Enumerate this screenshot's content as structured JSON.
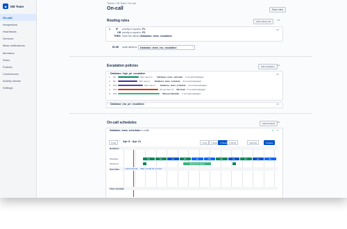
{
  "team": {
    "name": "DB Team"
  },
  "sidebar": {
    "items": [
      {
        "label": "On-call",
        "active": true
      },
      {
        "label": "Integrations"
      },
      {
        "label": "Heartbeats"
      },
      {
        "label": "Services"
      },
      {
        "label": "Mass notifications"
      },
      {
        "label": "Members"
      },
      {
        "label": "Roles"
      },
      {
        "label": "Policies"
      },
      {
        "label": "Conferences"
      },
      {
        "label": "Activity stream"
      },
      {
        "label": "Settings"
      }
    ]
  },
  "header": {
    "breadcrumb": [
      "Teams",
      "DB Team",
      "On-call"
    ],
    "title": "On-call",
    "save_label": "Save view"
  },
  "routing": {
    "title": "Routing rules",
    "add_label": "Add routing rule",
    "rule_num": "1",
    "if_label": "IF",
    "cond_text": "priority is equal to",
    "cond_val": "P1",
    "and_label": "OR",
    "cond2_text": "priority is equal to",
    "cond2_val": "P2",
    "then_label": "THEN",
    "then_text": "route the alerts to",
    "then_target": "Database_team_escalation",
    "else_label": "ELSE",
    "else_text": "route alerts to",
    "else_target": "Database_team_esc_escalation"
  },
  "escalation": {
    "title": "Escalation policies",
    "add_label": "Add escalation",
    "policy1": "Database_high_pri_escalation",
    "steps": [
      {
        "num": "1",
        "time": "0m",
        "text": "Alert users in",
        "target": "Database_team_schedule",
        "tail": "if not acknowledged",
        "color": "#00875a"
      },
      {
        "num": "2",
        "time": "5m",
        "text": "Alert user in",
        "target": "Database_team_schedule",
        "tail": "if not acknowledged",
        "color": "#403294"
      },
      {
        "num": "3",
        "time": "10m",
        "text": "Alert user in",
        "target": "Database_team_schedule",
        "tail": "if not acknowledged",
        "color": "#5243aa"
      },
      {
        "num": "4",
        "time": "15m",
        "text": "All members of",
        "target": "DB Team",
        "tail": "if not acknowledged",
        "color": "#de350b"
      },
      {
        "num": "5",
        "time": "20m",
        "text": "",
        "target": "Melissa Rebekah",
        "tail": "if not acknowledged",
        "color": "#36b37e"
      }
    ],
    "policy2": "Database_low_pri_escalation"
  },
  "schedules": {
    "title": "On-call schedules",
    "add_label": "Add schedule",
    "schedule_name": "Database_team_schedule",
    "timezone": "(GMT+03:00)",
    "today_label": "Today",
    "date_range": "Apr 8 - Apr 21",
    "views": [
      "1 Day",
      "1 Week",
      "2 Weeks",
      "1 Month"
    ],
    "active_view": "2 Weeks",
    "calendar_label": "Calendar",
    "timeline_label": "Timeline",
    "rotations_label": "Rotations",
    "rot1": "Weekday",
    "rot2": "Weekend",
    "rot2_tag": "Weekend rotation",
    "overrides_label": "Overrides",
    "add_override": "Add override",
    "take_call": "Take on-call for an hour",
    "final_label": "Final schedule",
    "row1": [
      {
        "name": "BA",
        "color": "#00875a"
      },
      {
        "name": "BA",
        "color": "#00875a"
      },
      {
        "name": "AA",
        "color": "#0052cc"
      },
      {
        "name": "BA",
        "color": "#00875a"
      },
      {
        "name": "MI",
        "color": "#0065ff"
      },
      {
        "name": "MH",
        "color": "#0065ff"
      },
      {
        "name": "BA",
        "color": "#00875a"
      },
      {
        "name": "AA",
        "color": "#0052cc"
      },
      {
        "name": "BA",
        "color": "#00875a"
      },
      {
        "name": "AA",
        "color": "#0052cc"
      },
      {
        "name": "Bo",
        "color": "#0065ff"
      }
    ]
  }
}
